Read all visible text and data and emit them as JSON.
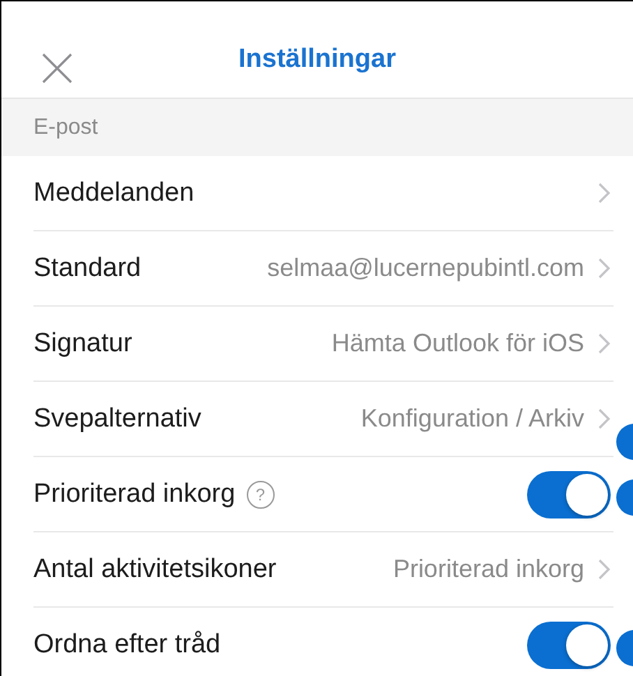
{
  "header": {
    "title": "Inställningar"
  },
  "section": {
    "title": "E-post"
  },
  "rows": [
    {
      "kind": "link",
      "label": "Meddelanden"
    },
    {
      "kind": "link",
      "label": "Standard",
      "value": "selmaa@lucernepubintl.com"
    },
    {
      "kind": "link",
      "label": "Signatur",
      "value": "Hämta Outlook för iOS"
    },
    {
      "kind": "link",
      "label": "Svepalternativ",
      "value": "Konfiguration / Arkiv"
    },
    {
      "kind": "toggle",
      "label": "Prioriterad inkorg",
      "help": "?",
      "on": true
    },
    {
      "kind": "link",
      "label": "Antal aktivitetsikoner",
      "value": "Prioriterad inkorg"
    },
    {
      "kind": "toggle",
      "label": "Ordna efter tråd",
      "on": true
    }
  ]
}
